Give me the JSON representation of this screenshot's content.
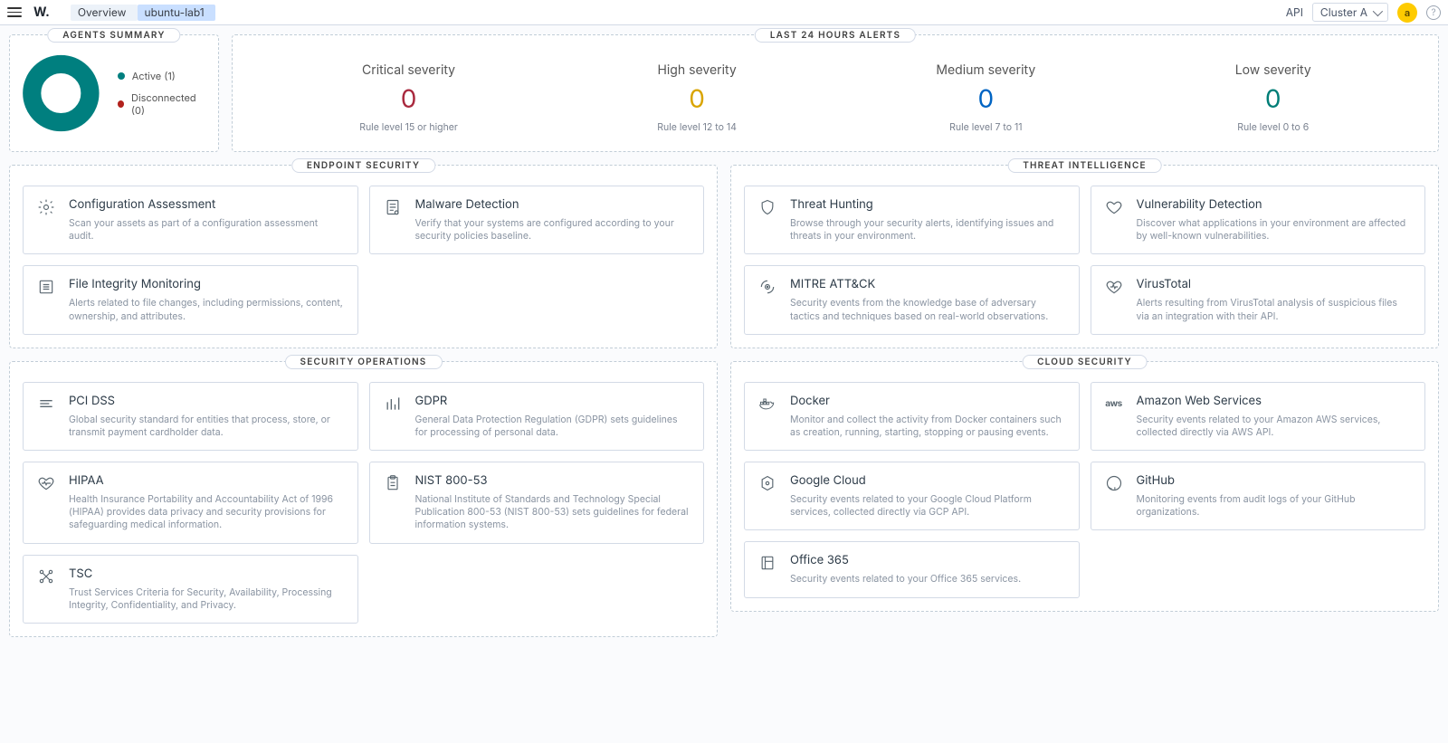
{
  "header": {
    "logo": "W.",
    "crumbs": [
      "Overview",
      "ubuntu-lab1"
    ],
    "api_label": "API",
    "cluster_label": "Cluster A",
    "avatar_initial": "a"
  },
  "agents_summary": {
    "title": "AGENTS SUMMARY",
    "legend": [
      {
        "key": "active",
        "label": "Active (1)"
      },
      {
        "key": "disconnected",
        "label": "Disconnected (0)"
      }
    ]
  },
  "alerts": {
    "title": "LAST 24 HOURS ALERTS",
    "cols": [
      {
        "label": "Critical severity",
        "value": "0",
        "class": "critical",
        "rule": "Rule level 15 or higher"
      },
      {
        "label": "High severity",
        "value": "0",
        "class": "high",
        "rule": "Rule level 12 to 14"
      },
      {
        "label": "Medium severity",
        "value": "0",
        "class": "medium",
        "rule": "Rule level 7 to 11"
      },
      {
        "label": "Low severity",
        "value": "0",
        "class": "low",
        "rule": "Rule level 0 to 6"
      }
    ]
  },
  "sections": {
    "endpoint": {
      "title": "ENDPOINT SECURITY",
      "cards": [
        {
          "icon": "gear",
          "title": "Configuration Assessment",
          "desc": "Scan your assets as part of a configuration assessment audit."
        },
        {
          "icon": "doc",
          "title": "Malware Detection",
          "desc": "Verify that your systems are configured according to your security policies baseline."
        },
        {
          "icon": "listdoc",
          "title": "File Integrity Monitoring",
          "desc": "Alerts related to file changes, including permissions, content, ownership, and attributes."
        }
      ]
    },
    "threat": {
      "title": "THREAT INTELLIGENCE",
      "cards": [
        {
          "icon": "shield",
          "title": "Threat Hunting",
          "desc": "Browse through your security alerts, identifying issues and threats in your environment."
        },
        {
          "icon": "heart",
          "title": "Vulnerability Detection",
          "desc": "Discover what applications in your environment are affected by well-known vulnerabilities."
        },
        {
          "icon": "target",
          "title": "MITRE ATT&CK",
          "desc": "Security events from the knowledge base of adversary tactics and techniques based on real-world observations."
        },
        {
          "icon": "pulse",
          "title": "VirusTotal",
          "desc": "Alerts resulting from VirusTotal analysis of suspicious files via an integration with their API."
        }
      ]
    },
    "secops": {
      "title": "SECURITY OPERATIONS",
      "cards": [
        {
          "icon": "stack",
          "title": "PCI DSS",
          "desc": "Global security standard for entities that process, store, or transmit payment cardholder data."
        },
        {
          "icon": "bars",
          "title": "GDPR",
          "desc": "General Data Protection Regulation (GDPR) sets guidelines for processing of personal data."
        },
        {
          "icon": "heartb",
          "title": "HIPAA",
          "desc": "Health Insurance Portability and Accountability Act of 1996 (HIPAA) provides data privacy and security provisions for safeguarding medical information."
        },
        {
          "icon": "clip",
          "title": "NIST 800-53",
          "desc": "National Institute of Standards and Technology Special Publication 800-53 (NIST 800-53) sets guidelines for federal information systems."
        },
        {
          "icon": "nodes",
          "title": "TSC",
          "desc": "Trust Services Criteria for Security, Availability, Processing Integrity, Confidentiality, and Privacy."
        }
      ]
    },
    "cloud": {
      "title": "CLOUD SECURITY",
      "cards": [
        {
          "icon": "docker",
          "title": "Docker",
          "desc": "Monitor and collect the activity from Docker containers such as creation, running, starting, stopping or pausing events."
        },
        {
          "icon": "aws",
          "title": "Amazon Web Services",
          "desc": "Security events related to your Amazon AWS services, collected directly via AWS API."
        },
        {
          "icon": "hex",
          "title": "Google Cloud",
          "desc": "Security events related to your Google Cloud Platform services, collected directly via GCP API."
        },
        {
          "icon": "github",
          "title": "GitHub",
          "desc": "Monitoring events from audit logs of your GitHub organizations."
        },
        {
          "icon": "office",
          "title": "Office 365",
          "desc": "Security events related to your Office 365 services."
        }
      ]
    }
  },
  "chart_data": {
    "type": "pie",
    "title": "Agents summary",
    "series": [
      {
        "name": "Active",
        "value": 1,
        "color": "#007f7f"
      },
      {
        "name": "Disconnected",
        "value": 0,
        "color": "#b2221d"
      }
    ]
  }
}
